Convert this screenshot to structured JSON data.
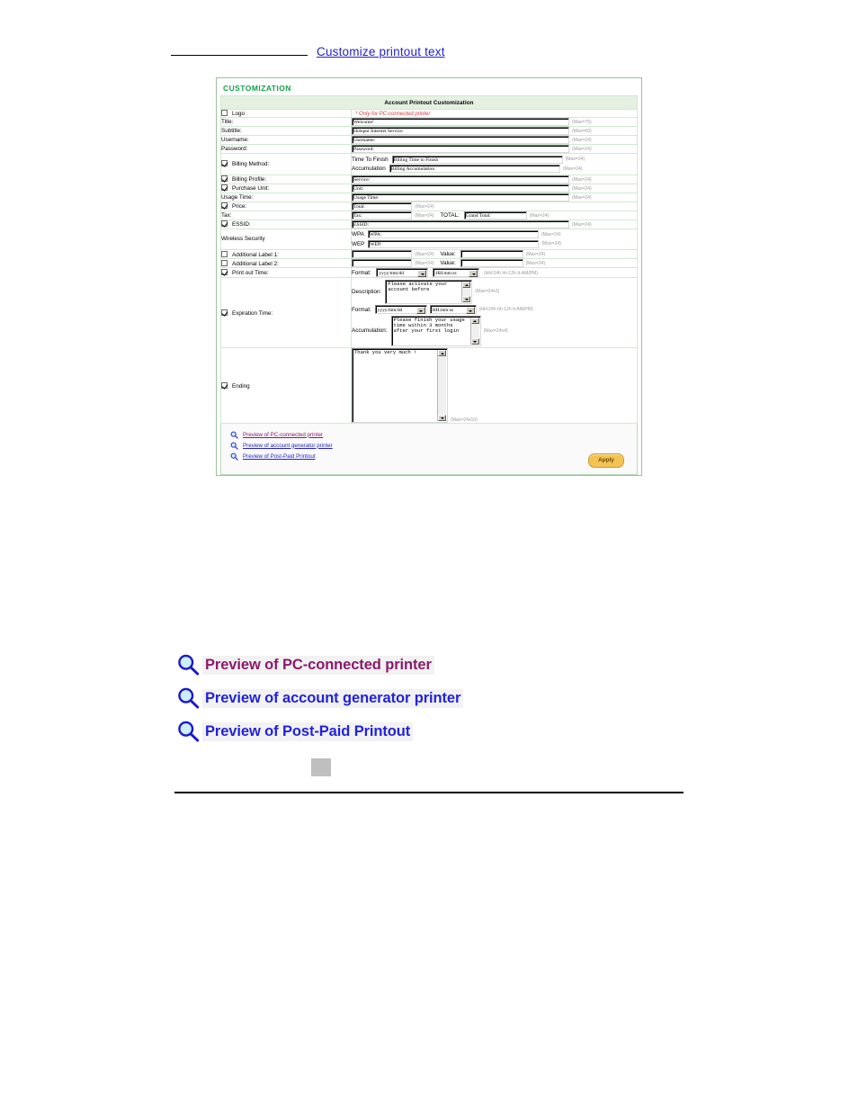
{
  "header": {
    "title": "Customize printout text"
  },
  "panel": {
    "section_title": "CUSTOMIZATION",
    "table_title": "Account Printout Customization"
  },
  "rows": {
    "logo": {
      "label": "Logo",
      "checked": false,
      "note": "* Only for PC-connected printer"
    },
    "title": {
      "label": "Title:",
      "value": "Welcome!",
      "max": "(Max=75)"
    },
    "subtitle": {
      "label": "Subtitle:",
      "value": "Hotspot Internet Service",
      "max": "(Max=60)"
    },
    "username": {
      "label": "Username:",
      "value": "Username:",
      "max": "(Max=24)"
    },
    "password": {
      "label": "Password:",
      "value": "Password:",
      "max": "(Max=24)"
    },
    "billing_method": {
      "label": "Billing Method:",
      "checked": true,
      "sub1_label": "Time To Finish",
      "sub1_value": "Billing Time to Finish",
      "sub1_max": "(Max=24)",
      "sub2_label": "Accumulation",
      "sub2_value": "Billing Accumulation",
      "sub2_max": "(Max=24)"
    },
    "billing_profile": {
      "label": "Billing Profile:",
      "checked": true,
      "value": "Service:",
      "max": "(Max=24)"
    },
    "purchase_unit": {
      "label": "Purchase Unit:",
      "checked": true,
      "value": "Unit:",
      "max": "(Max=24)"
    },
    "usage_time": {
      "label": "Usage Time:",
      "value": "Usage Time:",
      "max": "(Max=24)"
    },
    "price": {
      "label": "Price:",
      "checked": true,
      "value": "Total:",
      "max": "(Max=24)"
    },
    "tax": {
      "label": "Tax:",
      "value": "Tax:",
      "max": "(Max=24)",
      "total_label": "TOTAL:",
      "total_value": "Grand Total:",
      "total_max": "(Max=24)"
    },
    "essid": {
      "label": "ESSID:",
      "checked": true,
      "value": "ESSID:",
      "max": "(Max=24)"
    },
    "wireless_security": {
      "label": "Wireless Security",
      "wpa_label": "WPA",
      "wpa_value": "WPA:",
      "wpa_max": "(Max=24)",
      "wep_label": "WEP",
      "wep_value": "WEP:",
      "wep_max": "(Max=24)"
    },
    "additional_label_1": {
      "label": "Additional Label 1:",
      "checked": false,
      "value": "",
      "max": "(Max=24)",
      "value_label": "Value:",
      "value2": "",
      "max2": "(Max=24)"
    },
    "additional_label_2": {
      "label": "Additional Label 2:",
      "checked": false,
      "value": "",
      "max": "(Max=24)",
      "value_label": "Value:",
      "value2": "",
      "max2": "(Max=24)"
    },
    "print_out_time": {
      "label": "Print out Time:",
      "checked": true,
      "format_label": "Format:",
      "date_format": "yyyy/mm/dd",
      "time_format": "HH:mm:ss",
      "hint": "(HH:24h hh:12h tt:AM/PM)"
    },
    "expiration_time": {
      "label": "Expiration Time:",
      "checked": true,
      "description_label": "Description:",
      "description_value": "Please activate your account before",
      "description_max": "(Max=24x3)",
      "format_label": "Format:",
      "date_format": "yyyy/mm/dd",
      "time_format": "HH:mm:ss",
      "hint": "(HH:24h hh:12h tt:AM/PM)",
      "accumulation_label": "Accumulation:",
      "accumulation_value": "Please finish your usage time within 3 months after your first login",
      "accumulation_max": "(Max=24x4)"
    },
    "ending": {
      "label": "Ending",
      "checked": true,
      "value": "Thank you very much !",
      "max": "(Max=24x10)"
    }
  },
  "links": [
    {
      "label": "Preview of PC-connected printer",
      "state": "visited"
    },
    {
      "label": "Preview of account generator printer",
      "state": "unvisited"
    },
    {
      "label": "Preview of Post-Paid Printout",
      "state": "unvisited"
    }
  ],
  "apply": {
    "label": "Apply"
  },
  "callout": [
    {
      "label": "Preview of PC-connected printer",
      "state": "visited"
    },
    {
      "label": "Preview of account generator printer",
      "state": "unvisited"
    },
    {
      "label": "Preview of Post-Paid Printout",
      "state": "unvisited"
    }
  ],
  "colors": {
    "section_title": "#12a34a",
    "table_header_bg": "#e4f1e1",
    "link_visited": "#8b1a6b",
    "link_unvisited": "#2222cc",
    "apply_button": "#f5c352",
    "red_note": "#e03a3a"
  }
}
